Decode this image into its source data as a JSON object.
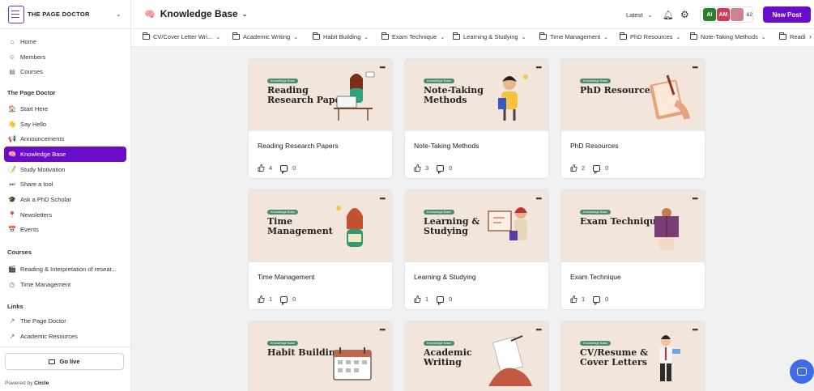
{
  "brand": {
    "name": "THE PAGE DOCTOR"
  },
  "sidebar": {
    "top": [
      {
        "label": "Home",
        "icon": "home-icon",
        "glyph": "⌂"
      },
      {
        "label": "Members",
        "icon": "members-icon",
        "glyph": "☺"
      },
      {
        "label": "Courses",
        "icon": "courses-icon",
        "glyph": "▤"
      }
    ],
    "section1_title": "The Page Doctor",
    "section1": [
      {
        "label": "Start Here",
        "icon": "house-emoji-icon",
        "glyph": "🏠"
      },
      {
        "label": "Say Hello",
        "icon": "wave-emoji-icon",
        "glyph": "👋"
      },
      {
        "label": "Announcements",
        "icon": "megaphone-icon",
        "glyph": "📢"
      },
      {
        "label": "Knowledge Base",
        "icon": "brain-emoji-icon",
        "glyph": "🧠",
        "active": true
      },
      {
        "label": "Study Motivation",
        "icon": "notepad-emoji-icon",
        "glyph": "📝"
      },
      {
        "label": "Share a tool",
        "icon": "play-emoji-icon",
        "glyph": "⏭"
      },
      {
        "label": "Ask a PhD Scholar",
        "icon": "grad-cap-emoji-icon",
        "glyph": "🎓"
      },
      {
        "label": "Newsletters",
        "icon": "pin-emoji-icon",
        "glyph": "📍"
      },
      {
        "label": "Events",
        "icon": "calendar-emoji-icon",
        "glyph": "📅"
      }
    ],
    "section2_title": "Courses",
    "section2": [
      {
        "label": "Reading & Interpretation of resear...",
        "icon": "clapper-emoji-icon",
        "glyph": "🎬"
      },
      {
        "label": "Time Management",
        "icon": "clock-icon",
        "glyph": "◷"
      }
    ],
    "section3_title": "Links",
    "section3": [
      {
        "label": "The Page Doctor",
        "icon": "external-link-icon",
        "glyph": "↗"
      },
      {
        "label": "Academic Resources",
        "icon": "external-link-icon",
        "glyph": "↗"
      }
    ],
    "go_live": "Go live",
    "powered_prefix": "Powered by",
    "powered_brand": "Circle"
  },
  "header": {
    "space_emoji": "🧠",
    "space_title": "Knowledge Base",
    "sort_label": "Latest",
    "members": [
      {
        "initials": "AI",
        "color": "#2f7d2f"
      },
      {
        "initials": "AM",
        "color": "#d03a5b"
      },
      {
        "initials": "",
        "color": "#c9848f"
      }
    ],
    "member_count": "62",
    "new_post": "New Post"
  },
  "tabs": [
    "CV/Cover Letter Wri...",
    "Academic Writing",
    "Habit Building",
    "Exam Technique",
    "Learning & Studying",
    "Time Management",
    "PhD Resources",
    "Note-Taking Methods",
    "Readi"
  ],
  "posts": [
    {
      "cover_tag": "Knowledge Base",
      "cover_title": "Reading\nResearch Papers",
      "title": "Reading Research Papers",
      "likes": "4",
      "comments": "0",
      "art": "laptop"
    },
    {
      "cover_tag": "Knowledge Base",
      "cover_title": "Note-Taking\nMethods",
      "title": "Note-Taking Methods",
      "likes": "3",
      "comments": "0",
      "art": "boy"
    },
    {
      "cover_tag": "Knowledge Base",
      "cover_title": "PhD Resources",
      "title": "PhD Resources",
      "likes": "2",
      "comments": "0",
      "art": "notebook"
    },
    {
      "cover_tag": "Knowledge Base",
      "cover_title": "Time\nManagement",
      "title": "Time Management",
      "likes": "1",
      "comments": "0",
      "art": "girl"
    },
    {
      "cover_tag": "Knowledge Base",
      "cover_title": "Learning &\nStudying",
      "title": "Learning & Studying",
      "likes": "1",
      "comments": "0",
      "art": "board"
    },
    {
      "cover_tag": "Knowledge Base",
      "cover_title": "Exam Technique",
      "title": "Exam Technique",
      "likes": "1",
      "comments": "0",
      "art": "book"
    },
    {
      "cover_tag": "Knowledge Base",
      "cover_title": "Habit Building",
      "title": "",
      "likes": "",
      "comments": "",
      "art": "calendar"
    },
    {
      "cover_tag": "Knowledge Base",
      "cover_title": "Academic\nWriting",
      "title": "",
      "likes": "",
      "comments": "",
      "art": "writing"
    },
    {
      "cover_tag": "Knowledge Base",
      "cover_title": "CV/Resume &\nCover Letters",
      "title": "",
      "likes": "",
      "comments": "",
      "art": "man"
    }
  ]
}
